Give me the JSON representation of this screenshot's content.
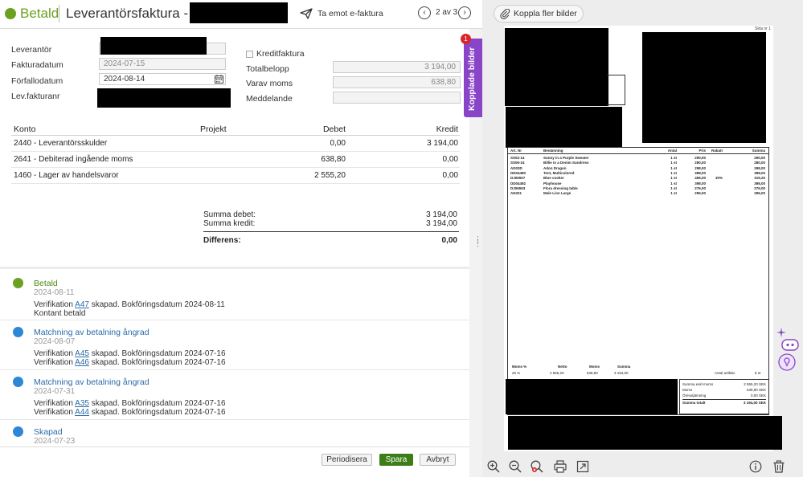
{
  "header": {
    "status": "Betald",
    "title": "Leverantörsfaktura - 3",
    "efaktura_label": "Ta emot e-faktura",
    "pager": "2 av 3"
  },
  "form": {
    "leverantor_label": "Leverantör",
    "fakturadatum_label": "Fakturadatum",
    "fakturadatum_value": "2024-07-15",
    "forfallodatum_label": "Förfallodatum",
    "forfallodatum_value": "2024-08-14",
    "levfakturanr_label": "Lev.fakturanr",
    "kreditfaktura_label": "Kreditfaktura",
    "totalbelopp_label": "Totalbelopp",
    "totalbelopp_value": "3 194,00",
    "varav_moms_label": "Varav moms",
    "varav_moms_value": "638,80",
    "meddelande_label": "Meddelande",
    "meddelande_value": ""
  },
  "konto_table": {
    "headers": {
      "konto": "Konto",
      "projekt": "Projekt",
      "debet": "Debet",
      "kredit": "Kredit"
    },
    "rows": [
      {
        "konto": "2440  -  Leverantörsskulder",
        "projekt": "",
        "debet": "0,00",
        "kredit": "3 194,00"
      },
      {
        "konto": "2641  -  Debiterad ingående moms",
        "projekt": "",
        "debet": "638,80",
        "kredit": "0,00"
      },
      {
        "konto": "1460  -  Lager av handelsvaror",
        "projekt": "",
        "debet": "2 555,20",
        "kredit": "0,00"
      }
    ]
  },
  "summary": {
    "summa_debet_label": "Summa debet:",
    "summa_debet_value": "3 194,00",
    "summa_kredit_label": "Summa kredit:",
    "summa_kredit_value": "3 194,00",
    "differens_label": "Differens:",
    "differens_value": "0,00"
  },
  "timeline": [
    {
      "title": "Betald",
      "date": "2024-08-11",
      "color": "#6aa121",
      "title_color": "#4f8a12",
      "lines": [
        {
          "pre": "Verifikation ",
          "link": "A47",
          "post": " skapad. Bokföringsdatum 2024-08-11"
        },
        {
          "pre": "Kontant betald",
          "link": "",
          "post": ""
        }
      ]
    },
    {
      "title": "Matchning av betalning ångrad",
      "date": "2024-08-07",
      "color": "#2e86d6",
      "title_color": "#2b6aa8",
      "lines": [
        {
          "pre": "Verifikation ",
          "link": "A45",
          "post": " skapad. Bokföringsdatum 2024-07-16"
        },
        {
          "pre": "Verifikation ",
          "link": "A46",
          "post": " skapad. Bokföringsdatum 2024-07-16"
        }
      ]
    },
    {
      "title": "Matchning av betalning ångrad",
      "date": "2024-07-31",
      "color": "#2e86d6",
      "title_color": "#2b6aa8",
      "lines": [
        {
          "pre": "Verifikation ",
          "link": "A35",
          "post": " skapad. Bokföringsdatum 2024-07-16"
        },
        {
          "pre": "Verifikation ",
          "link": "A44",
          "post": " skapad. Bokföringsdatum 2024-07-16"
        }
      ]
    },
    {
      "title": "Skapad",
      "date": "2024-07-23",
      "color": "#2e86d6",
      "title_color": "#2b6aa8",
      "lines": []
    }
  ],
  "footer": {
    "periodisera": "Periodisera",
    "spara": "Spara",
    "avbryt": "Avbryt"
  },
  "kopplade": {
    "label": "Kopplade bilder",
    "badge": "1"
  },
  "viewer": {
    "koppla_label": "Koppla fler bilder",
    "page_nr": "Sida nr 1",
    "invoice_headers": {
      "art": "Art. Nr",
      "ben": "Benämning",
      "antal": "Antal",
      "pris": "Pris",
      "rabatt": "Rabatt",
      "summa": "Summa"
    },
    "invoice_rows": [
      {
        "art": "SS02-14",
        "ben": "Sunny in a Purple Sweater",
        "antal": "1 st",
        "pris": "290,00",
        "rabatt": "",
        "summa": "290,00"
      },
      {
        "art": "SS06-24",
        "ben": "Billie in a Denim Sundress",
        "antal": "1 st",
        "pris": "280,00",
        "rabatt": "",
        "summa": "280,00"
      },
      {
        "art": "AD03D",
        "ben": "Adon Dragon",
        "antal": "1 st",
        "pris": "298,00",
        "rabatt": "",
        "summa": "298,00"
      },
      {
        "art": "DD04490",
        "ben": "Tent, Multicolored",
        "antal": "1 st",
        "pris": "398,00",
        "rabatt": "",
        "summa": "398,00"
      },
      {
        "art": "DJ06507",
        "ben": "Blue cooker",
        "antal": "1 st",
        "pris": "456,00",
        "rabatt": "30%",
        "summa": "319,20"
      },
      {
        "art": "DD04492",
        "ben": "Playhouse",
        "antal": "1 st",
        "pris": "398,00",
        "rabatt": "",
        "summa": "398,00"
      },
      {
        "art": "DJ06553",
        "ben": "Flora dressing table",
        "antal": "1 st",
        "pris": "276,00",
        "rabatt": "",
        "summa": "276,00"
      },
      {
        "art": "AN321",
        "ben": "Male Lion Large",
        "antal": "1 st",
        "pris": "296,00",
        "rabatt": "",
        "summa": "296,00"
      }
    ],
    "moms_headers": {
      "moms_pct": "Moms %",
      "netto": "Netto",
      "moms": "Moms",
      "summa": "Summa"
    },
    "moms_values": {
      "moms_pct": "25 %",
      "netto": "2 555,20",
      "moms": "638,80",
      "summa": "3 194,00"
    },
    "antal_artiklar_label": "Antal artiklar:",
    "antal_artiklar_value": "8 st",
    "totals": [
      {
        "label": "Summa exkl moms",
        "value": "2 555,20 SEK"
      },
      {
        "label": "Moms",
        "value": "638,80 SEK"
      },
      {
        "label": "Öresutjämning",
        "value": "0,00 SEK"
      },
      {
        "label": "Summa totalt",
        "value": "3 194,00 SEK"
      }
    ]
  },
  "colors": {
    "green": "#6aa121",
    "blue": "#2e86d6",
    "purple": "#8a44c8",
    "spara": "#3b7d16"
  }
}
